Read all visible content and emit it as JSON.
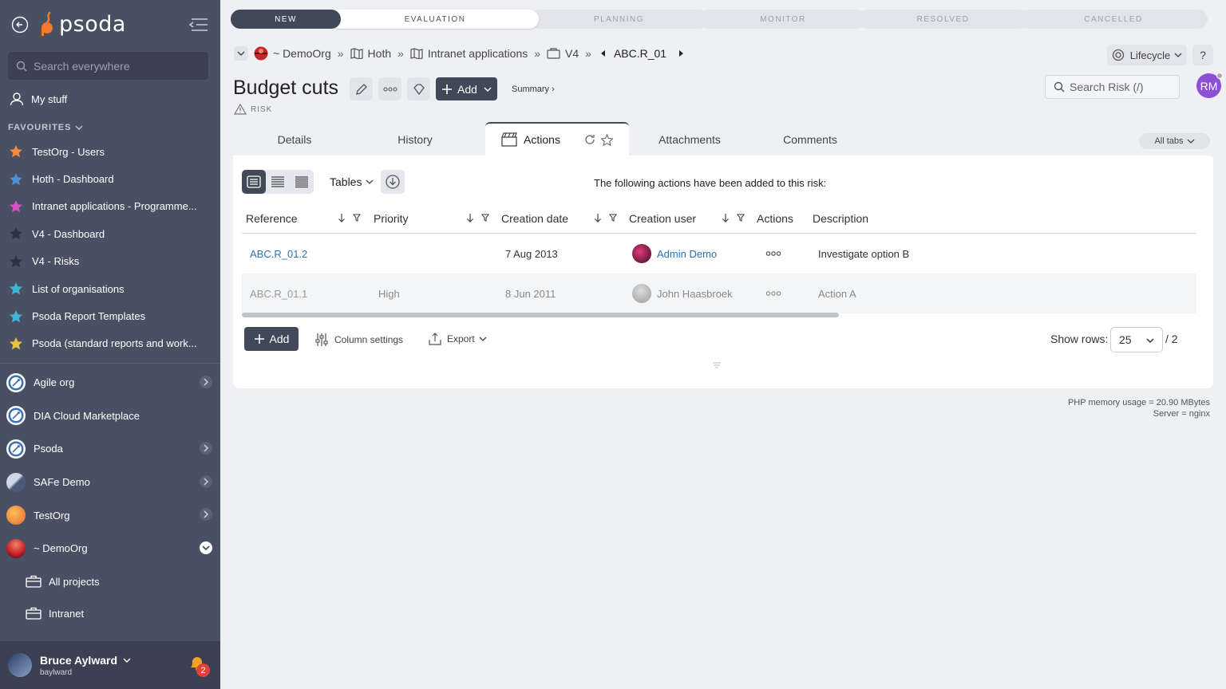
{
  "sidebar": {
    "logo_text": "psoda",
    "search_placeholder": "Search everywhere",
    "my_stuff": "My stuff",
    "favourites_heading": "FAVOURITES",
    "favourites": [
      {
        "label": "TestOrg - Users",
        "star_color": "#f08a3c"
      },
      {
        "label": "Hoth - Dashboard",
        "star_color": "#4c8fd6"
      },
      {
        "label": "Intranet applications - Programme...",
        "star_color": "#d84fc0"
      },
      {
        "label": "V4 - Dashboard",
        "star_color": "#2e3240"
      },
      {
        "label": "V4 - Risks",
        "star_color": "#2e3240"
      },
      {
        "label": "List of organisations",
        "star_color": "#3fb5d8"
      },
      {
        "label": "Psoda Report Templates",
        "star_color": "#3fb5d8"
      },
      {
        "label": "Psoda (standard reports and work...",
        "star_color": "#e8c23a"
      }
    ],
    "orgs": [
      {
        "label": "Agile org",
        "has_arrow": true
      },
      {
        "label": "DIA Cloud Marketplace",
        "has_arrow": false
      },
      {
        "label": "Psoda",
        "has_arrow": true
      },
      {
        "label": "SAFe Demo",
        "has_arrow": true
      },
      {
        "label": "TestOrg",
        "has_arrow": true
      },
      {
        "label": "~ DemoOrg",
        "has_arrow": true
      }
    ],
    "sub_items": [
      "All projects",
      "Intranet"
    ],
    "user": {
      "name": "Bruce Aylward",
      "username": "baylward",
      "notifications": "2"
    }
  },
  "lifecycle": [
    "NEW",
    "EVALUATION",
    "PLANNING",
    "MONITOR",
    "RESOLVED",
    "CANCELLED"
  ],
  "breadcrumb": {
    "org": "~ DemoOrg",
    "items": [
      "Hoth",
      "Intranet applications",
      "V4"
    ],
    "current": "ABC.R_01"
  },
  "header": {
    "lifecycle_button": "Lifecycle",
    "help": "?",
    "title": "Budget cuts",
    "add_label": "Add",
    "summary_link": "Summary ›",
    "type_label": "RISK",
    "search_placeholder": "Search Risk (/)",
    "avatar_initials": "RM"
  },
  "tabs": {
    "items": [
      "Details",
      "History",
      "Actions",
      "Attachments",
      "Comments"
    ],
    "active": "Actions",
    "all_tabs": "All tabs"
  },
  "panel": {
    "tables_label": "Tables",
    "message": "The following actions have been added to this risk:",
    "columns": [
      "Reference",
      "Priority",
      "Creation date",
      "Creation user",
      "Actions",
      "Description"
    ],
    "rows": [
      {
        "reference": "ABC.R_01.2",
        "priority": "",
        "creation_date": "7 Aug 2013",
        "creation_user": "Admin Demo",
        "actions": "ooo",
        "description": "Investigate option B"
      },
      {
        "reference": "ABC.R_01.1",
        "priority": "High",
        "creation_date": "8 Jun 2011",
        "creation_user": "John Haasbroek",
        "actions": "ooo",
        "description": "Action A"
      }
    ],
    "add_label": "Add",
    "column_settings": "Column settings",
    "export": "Export",
    "show_rows_label": "Show rows:",
    "rows_value": "25",
    "pages": "/ 2"
  },
  "footer": {
    "memory": "PHP memory usage = 20.90 MBytes",
    "server": "Server = nginx"
  }
}
